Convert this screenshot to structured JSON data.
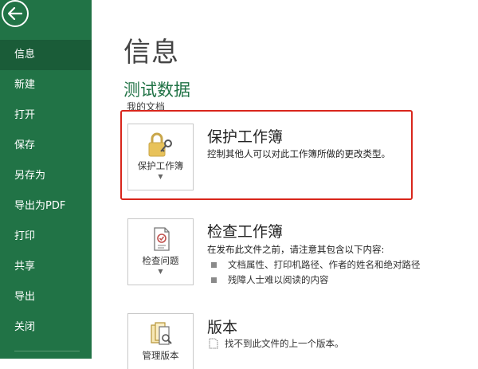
{
  "sidebar": {
    "items": [
      {
        "label": "信息",
        "active": true
      },
      {
        "label": "新建"
      },
      {
        "label": "打开"
      },
      {
        "label": "保存"
      },
      {
        "label": "另存为"
      },
      {
        "label": "导出为PDF"
      },
      {
        "label": "打印"
      },
      {
        "label": "共享"
      },
      {
        "label": "导出"
      },
      {
        "label": "关闭"
      }
    ]
  },
  "main": {
    "title": "信息",
    "doc_name": "测试数据",
    "doc_path": "我的文档",
    "protect": {
      "button_label": "保护工作簿",
      "title": "保护工作簿",
      "description": "控制其他人可以对此工作簿所做的更改类型。"
    },
    "inspect": {
      "button_label": "检查问题",
      "title": "检查工作簿",
      "description": "在发布此文件之前，请注意其包含以下内容:",
      "bullets": [
        "文档属性、打印机路径、作者的姓名和绝对路径",
        "残障人士难以阅读的内容"
      ]
    },
    "versions": {
      "button_label": "管理版本",
      "title": "版本",
      "note": "找不到此文件的上一个版本。"
    }
  },
  "colors": {
    "sidebar": "#217346",
    "sidebar_active": "#1a5c38",
    "accent": "#217346",
    "highlight": "#d9261c"
  }
}
